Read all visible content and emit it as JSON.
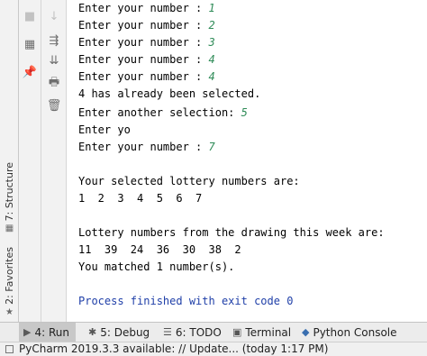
{
  "side_tabs": {
    "structure": "7: Structure",
    "favorites": "2: Favorites"
  },
  "action_icons": {
    "col1": [
      "stop-icon",
      "layout-icon",
      "pin-icon"
    ],
    "col2": [
      "down-arrow-icon",
      "soft-wrap-icon",
      "scroll-to-end-icon",
      "print-icon",
      "trash-icon"
    ]
  },
  "console": {
    "lines": [
      {
        "prompt": "Enter your number : ",
        "input": "1"
      },
      {
        "prompt": "Enter your number : ",
        "input": "2"
      },
      {
        "prompt": "Enter your number : ",
        "input": "3"
      },
      {
        "prompt": "Enter your number : ",
        "input": "4"
      },
      {
        "prompt": "Enter your number : ",
        "input": "4"
      },
      {
        "prompt": "4 has already been selected.",
        "input": ""
      },
      {
        "prompt": "Enter another selection: ",
        "input": "5"
      },
      {
        "prompt": "Enter yo",
        "input": ""
      },
      {
        "prompt": "Enter your number : ",
        "input": "7"
      },
      {
        "prompt": "",
        "input": ""
      },
      {
        "prompt": "Your selected lottery numbers are:",
        "input": ""
      },
      {
        "prompt": "1  2  3  4  5  6  7",
        "input": ""
      },
      {
        "prompt": "",
        "input": ""
      },
      {
        "prompt": "Lottery numbers from the drawing this week are:",
        "input": ""
      },
      {
        "prompt": "11  39  24  36  30  38  2",
        "input": ""
      },
      {
        "prompt": "You matched 1 number(s).",
        "input": ""
      },
      {
        "prompt": "",
        "input": ""
      },
      {
        "prompt": "Process finished with exit code 0",
        "input": ""
      }
    ]
  },
  "bottom_tabs": {
    "run": "4: Run",
    "debug": "5: Debug",
    "todo": "6: TODO",
    "terminal": "Terminal",
    "python_console": "Python Console"
  },
  "status": {
    "message": "PyCharm 2019.3.3 available: // Update... (today 1:17 PM)"
  },
  "colors": {
    "input_text": "#2e8b57",
    "exit_text": "#1f3fa8"
  }
}
